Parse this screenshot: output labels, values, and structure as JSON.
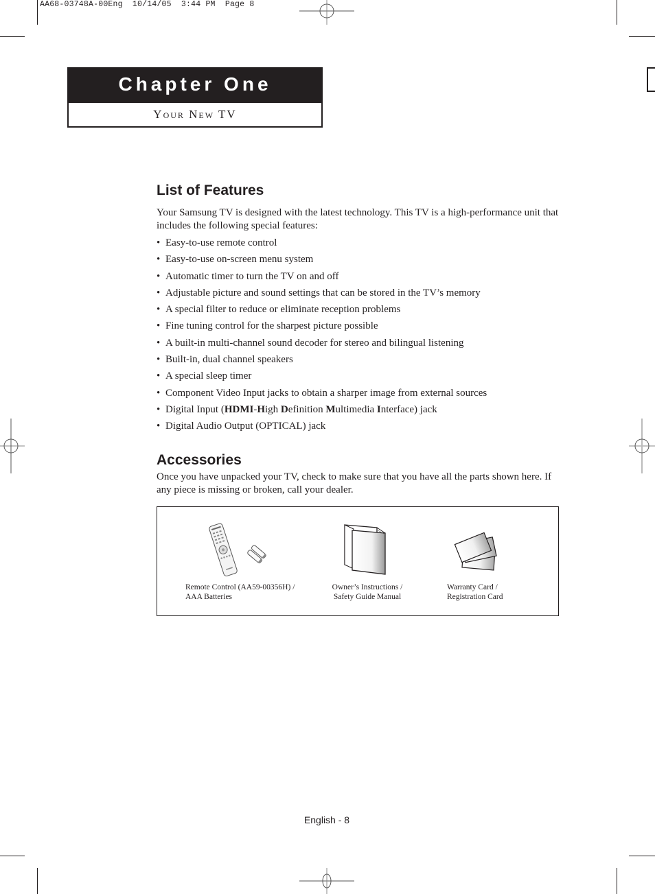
{
  "slug": {
    "text": "AA68-03748A-00Eng  10/14/05  3:44 PM  Page 8"
  },
  "chapter": {
    "title": "Chapter One",
    "subtitle": "Your New TV"
  },
  "features": {
    "heading": "List of Features",
    "intro": "Your Samsung TV is designed with the latest technology. This TV is a high-performance unit that includes the following special features:",
    "bullet": "•",
    "items": [
      "Easy-to-use remote control",
      "Easy-to-use on-screen menu system",
      "Automatic timer to turn the TV on and off",
      "Adjustable picture and sound settings that can be stored in the TV’s memory",
      "A special filter to reduce or eliminate reception problems",
      "Fine tuning control for the sharpest picture possible",
      "A built-in multi-channel sound decoder for stereo and bilingual listening",
      "Built-in, dual channel speakers",
      "A special sleep timer",
      "Component Video Input jacks to obtain a sharper image from external sources"
    ],
    "hdmi_item": {
      "p1": "Digital Input (",
      "b1": "HDMI",
      "p2": "-",
      "b2": "H",
      "p3": "igh ",
      "b3": "D",
      "p4": "efinition ",
      "b4": "M",
      "p5": "ultimedia ",
      "b5": "I",
      "p6": "nterface) jack"
    },
    "last_item": "Digital Audio Output (OPTICAL) jack"
  },
  "accessories": {
    "heading": "Accessories",
    "intro": "Once you have unpacked your TV, check to make sure that you have all the parts shown here. If any piece is missing or broken, call your dealer.",
    "items": [
      {
        "icon": "remote-control-icon",
        "line1": "Remote Control (AA59-00356H) /",
        "line2": "AAA Batteries"
      },
      {
        "icon": "manual-booklet-icon",
        "line1": "Owner’s Instructions /",
        "line2": "Safety Guide Manual"
      },
      {
        "icon": "warranty-card-icon",
        "line1": "Warranty Card /",
        "line2": "Registration Card"
      }
    ]
  },
  "footer": {
    "page_label": "English - 8"
  }
}
